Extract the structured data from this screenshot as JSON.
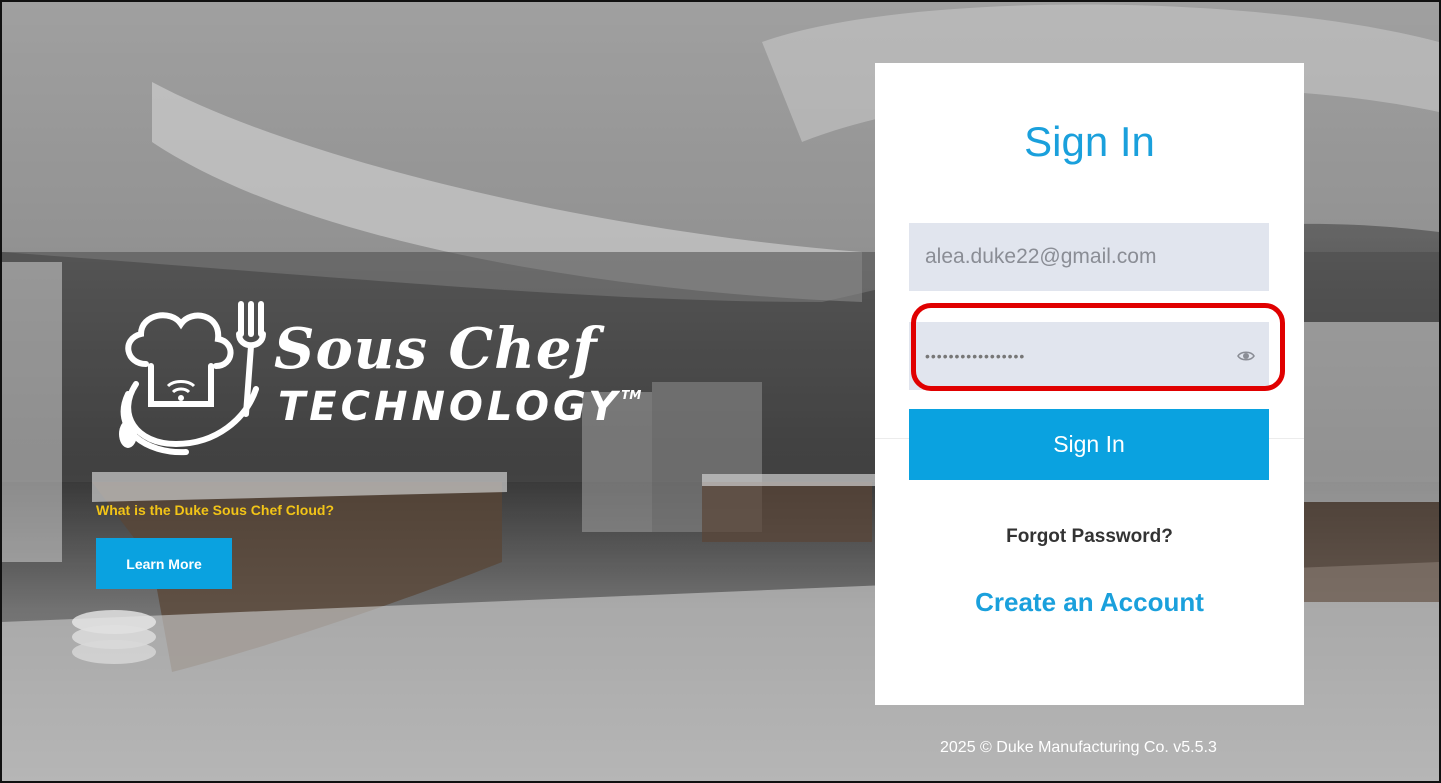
{
  "branding": {
    "logo_title": "Sous Chef",
    "logo_subtitle": "TECHNOLOGY",
    "logo_trademark": "TM",
    "tagline": "What is the Duke Sous Chef Cloud?",
    "learn_more_label": "Learn More"
  },
  "signin": {
    "title": "Sign In",
    "email_value": "alea.duke22@gmail.com",
    "password_value": "•••••••••••••••••",
    "submit_label": "Sign In",
    "forgot_label": "Forgot Password?",
    "create_label": "Create an Account"
  },
  "footer": {
    "text": "2025 © Duke Manufacturing Co. v5.5.3"
  },
  "colors": {
    "accent": "#0aa2e0",
    "tagline": "#f2c417",
    "highlight": "#e00000",
    "field_bg": "#e1e5ee"
  },
  "icons": {
    "logo": "chef-hat-fork-icon",
    "password_toggle": "eye-icon"
  }
}
